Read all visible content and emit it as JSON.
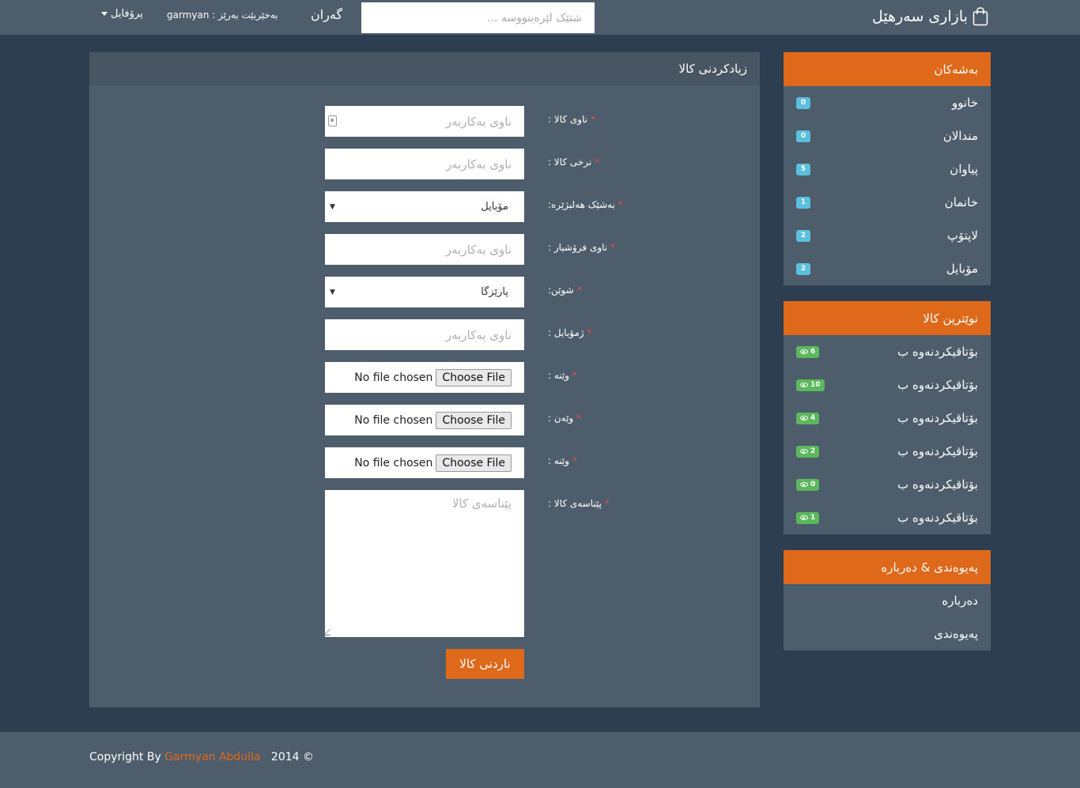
{
  "navbar": {
    "brand": "بازاری سەرهێل",
    "search_placeholder": "شتێک لێرەبنووسە ...",
    "search_label": "گەران",
    "welcome": "بەخێربێت بەرێز : garmyan",
    "profile_label": "پرۆفایل"
  },
  "form": {
    "heading": "زیادکردنی کالا",
    "required_mark": "*",
    "fields": [
      {
        "label": "ناوی کالا :",
        "placeholder": "ناوی بەکاربەر"
      },
      {
        "label": "نرخی کالا :",
        "placeholder": "ناوی بەکاربەر"
      },
      {
        "label": "بەشێک هەلبژێرە:",
        "value": "مۆبایل"
      },
      {
        "label": "ناوی فرۆشیار :",
        "placeholder": "ناوی بەکاربەر"
      },
      {
        "label": "شوێن:",
        "value": "پارێزگا"
      },
      {
        "label": "ژمۆبایل :",
        "placeholder": "ناوی بەکاربەر"
      },
      {
        "label": "وێنە :",
        "button": "Choose File",
        "status": "No file chosen"
      },
      {
        "label": "وێەن :",
        "button": "Choose File",
        "status": "No file chosen"
      },
      {
        "label": "وێنە :",
        "button": "Choose File",
        "status": "No file chosen"
      },
      {
        "label": "پێناسەی کالا :",
        "placeholder": "پێناسەی کالا"
      }
    ],
    "submit_label": "ناردنی کالا"
  },
  "sidebar": {
    "categories": {
      "heading": "بەشەکان",
      "items": [
        {
          "label": "خانوو",
          "count": "0"
        },
        {
          "label": "مندالان",
          "count": "0"
        },
        {
          "label": "پیاوان",
          "count": "5"
        },
        {
          "label": "خانمان",
          "count": "1"
        },
        {
          "label": "لاپتۆپ",
          "count": "2"
        },
        {
          "label": "مۆبایل",
          "count": "2"
        }
      ]
    },
    "latest": {
      "heading": "نوێترین کالا",
      "items": [
        {
          "label": "بۆتاقیکردنەوە ب",
          "views": "6"
        },
        {
          "label": "بۆتاقیکردنەوە ب",
          "views": "10"
        },
        {
          "label": "بۆتاقیکردنەوە ب",
          "views": "4"
        },
        {
          "label": "بۆتاقیکردنەوە ب",
          "views": "2"
        },
        {
          "label": "بۆتاقیکردنەوە ب",
          "views": "0"
        },
        {
          "label": "بۆتاقیکردنەوە ب",
          "views": "1"
        }
      ]
    },
    "contact": {
      "heading": "پەیوەندی & دەربارە",
      "items": [
        {
          "label": "دەربارە"
        },
        {
          "label": "پەیوەندی"
        }
      ]
    }
  },
  "footer": {
    "prefix": "Copyright By",
    "author": "Garmyan Abdulla",
    "year": "2014 ©"
  },
  "colors": {
    "accent": "#df691a",
    "background": "#2c3e50",
    "panel": "#4e5d6c",
    "badge_info": "#5bc0de",
    "badge_success": "#5cb85c"
  }
}
